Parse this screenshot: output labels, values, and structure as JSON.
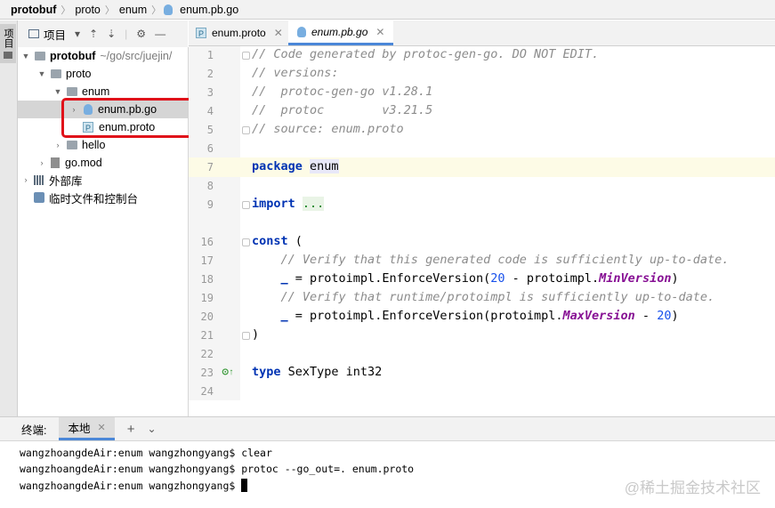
{
  "breadcrumb": [
    "protobuf",
    "proto",
    "enum",
    "enum.pb.go"
  ],
  "toolstrip": {
    "project_tab": "项目"
  },
  "project_panel": {
    "title": "项目",
    "tree": [
      {
        "label": "protobuf",
        "sublabel": "~/go/src/juejin/",
        "icon": "folder-icon",
        "expanded": true
      },
      {
        "label": "proto",
        "icon": "folder-icon",
        "expanded": true
      },
      {
        "label": "enum",
        "icon": "folder-icon",
        "expanded": true
      },
      {
        "label": "enum.pb.go",
        "icon": "go-file-icon",
        "selected": true
      },
      {
        "label": "enum.proto",
        "icon": "proto-file-icon"
      },
      {
        "label": "hello",
        "icon": "folder-icon"
      },
      {
        "label": "go.mod",
        "icon": "go-mod-icon"
      },
      {
        "label": "外部库",
        "icon": "library-icon"
      },
      {
        "label": "临时文件和控制台",
        "icon": "scratch-icon"
      }
    ]
  },
  "tabs": [
    {
      "label": "enum.proto",
      "icon": "P",
      "active": false
    },
    {
      "label": "enum.pb.go",
      "icon": "go-file-icon",
      "active": true
    }
  ],
  "editor": {
    "line_numbers": [
      "1",
      "2",
      "3",
      "4",
      "5",
      "6",
      "7",
      "8",
      "9",
      "16",
      "17",
      "18",
      "19",
      "20",
      "21",
      "22",
      "23",
      "24"
    ],
    "lines": {
      "l1": "// Code generated by protoc-gen-go. DO NOT EDIT.",
      "l2": "// versions:",
      "l3": "//  protoc-gen-go v1.28.1",
      "l4": "//  protoc        v3.21.5",
      "l5": "// source: enum.proto",
      "l7_kw": "package",
      "l7_name": "enum",
      "l9_kw": "import",
      "l9_rest": "...",
      "l16_kw": "const",
      "l16_rest": " (",
      "l17": "    // Verify that this generated code is sufficiently up-to-date.",
      "l18_blank": "_",
      "l18_a": " = protoimpl.EnforceVersion(",
      "l18_num": "20",
      "l18_b": " - protoimpl.",
      "l18_it": "MinVersion",
      "l18_c": ")",
      "l19": "    // Verify that runtime/protoimpl is sufficiently up-to-date.",
      "l20_blank": "_",
      "l20_a": " = protoimpl.EnforceVersion(protoimpl.",
      "l20_it": "MaxVersion",
      "l20_b": " - ",
      "l20_num": "20",
      "l20_c": ")",
      "l21": ")",
      "l23_kw": "type",
      "l23_rest": " SexType int32"
    }
  },
  "terminal": {
    "label": "终端:",
    "tab": "本地",
    "lines": [
      "wangzhoangdeAir:enum wangzhongyang$ clear",
      "wangzhoangdeAir:enum wangzhongyang$ protoc --go_out=. enum.proto",
      "wangzhoangdeAir:enum wangzhongyang$ "
    ]
  },
  "watermark": "@稀土掘金技术社区",
  "colors": {
    "accent": "#4b87d8",
    "highlight_box": "#e0121a",
    "keyword": "#0033b3",
    "comment": "#8c8c8c"
  }
}
